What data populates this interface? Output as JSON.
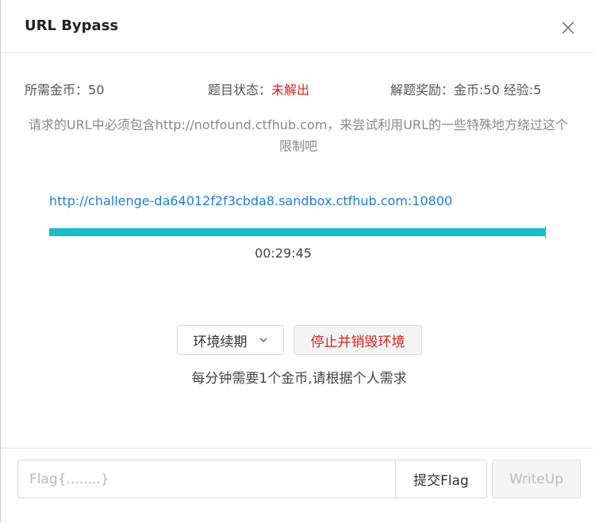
{
  "header": {
    "title": "URL Bypass"
  },
  "info": {
    "coins_label": "所需金币：",
    "coins_value": "50",
    "status_label": "题目状态：",
    "status_value": "未解出",
    "reward_label": "解题奖励：",
    "reward_value": "金币:50 经验:5"
  },
  "description": "请求的URL中必须包含http://notfound.ctfhub.com，来尝试利用URL的一些特殊地方绕过这个限制吧",
  "challenge": {
    "url": "http://challenge-da64012f2f3cbda8.sandbox.ctfhub.com:10800",
    "time_remaining": "00:29:45",
    "progress_fraction": 1.0
  },
  "actions": {
    "renew_label": "环境续期",
    "destroy_label": "停止并销毁环境",
    "note": "每分钟需要1个金币,请根据个人需求"
  },
  "footer": {
    "flag_placeholder": "Flag{........}",
    "flag_value": "",
    "submit_label": "提交Flag",
    "writeup_label": "WriteUp"
  },
  "icons": {
    "close": "close-icon",
    "renew_dropdown": "chevron-down-icon"
  },
  "colors": {
    "accent": "#17bec4",
    "link": "#1f7ce0",
    "status_unsolved": "#e02020",
    "danger_text": "#e02020"
  }
}
